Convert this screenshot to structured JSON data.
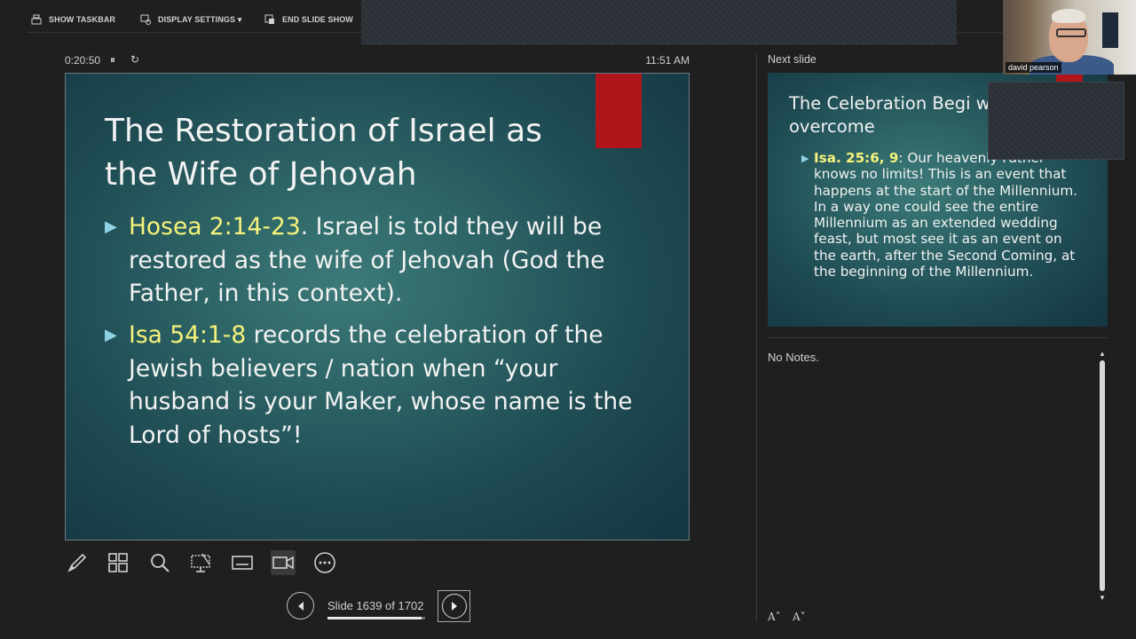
{
  "toolbar": {
    "show_taskbar": "SHOW TASKBAR",
    "display_settings": "DISPLAY SETTINGS ▾",
    "end_slide_show": "END SLIDE SHOW"
  },
  "timer": {
    "elapsed": "0:20:50",
    "pause_glyph": "⏸",
    "restart_glyph": "↻",
    "clock": "11:51 AM"
  },
  "current_slide": {
    "title": "The Restoration of Israel as the Wife of Jehovah",
    "bullets": [
      {
        "ref": "Hosea 2:14-23",
        "text": ". Israel is told they will be restored as the wife of Jehovah (God the Father, in this context)."
      },
      {
        "ref": "Isa 54:1-8",
        "text": " records the celebration of the Jewish believers / nation when “your husband is your Maker, whose name is the Lord of hosts”!"
      }
    ],
    "accent_color": "#b0151b",
    "highlight_color": "#f7f37a"
  },
  "tools": [
    {
      "name": "pen-icon"
    },
    {
      "name": "see-all-slides-icon"
    },
    {
      "name": "zoom-icon"
    },
    {
      "name": "black-screen-icon"
    },
    {
      "name": "subtitles-icon"
    },
    {
      "name": "camera-icon"
    },
    {
      "name": "more-options-icon"
    }
  ],
  "navigation": {
    "slide_counter": "Slide 1639 of 1702",
    "progress_fraction": 0.963
  },
  "next_slide": {
    "label": "Next slide",
    "title": "The Celebration Begi with all the overcome",
    "bullet_ref": "Isa. 25:6, 9",
    "bullet_text": ": Our heavenly Father knows no limits! This is an event that happens at the start of the Millennium. In a way one could see the entire Millennium as an extended wedding feast, but most see it as an event on the earth, after the Second Coming, at the beginning of the Millennium."
  },
  "notes": {
    "text": "No Notes.",
    "increase_font": "A˄",
    "decrease_font": "A˅"
  },
  "webcam": {
    "participant_name": "david pearson"
  }
}
